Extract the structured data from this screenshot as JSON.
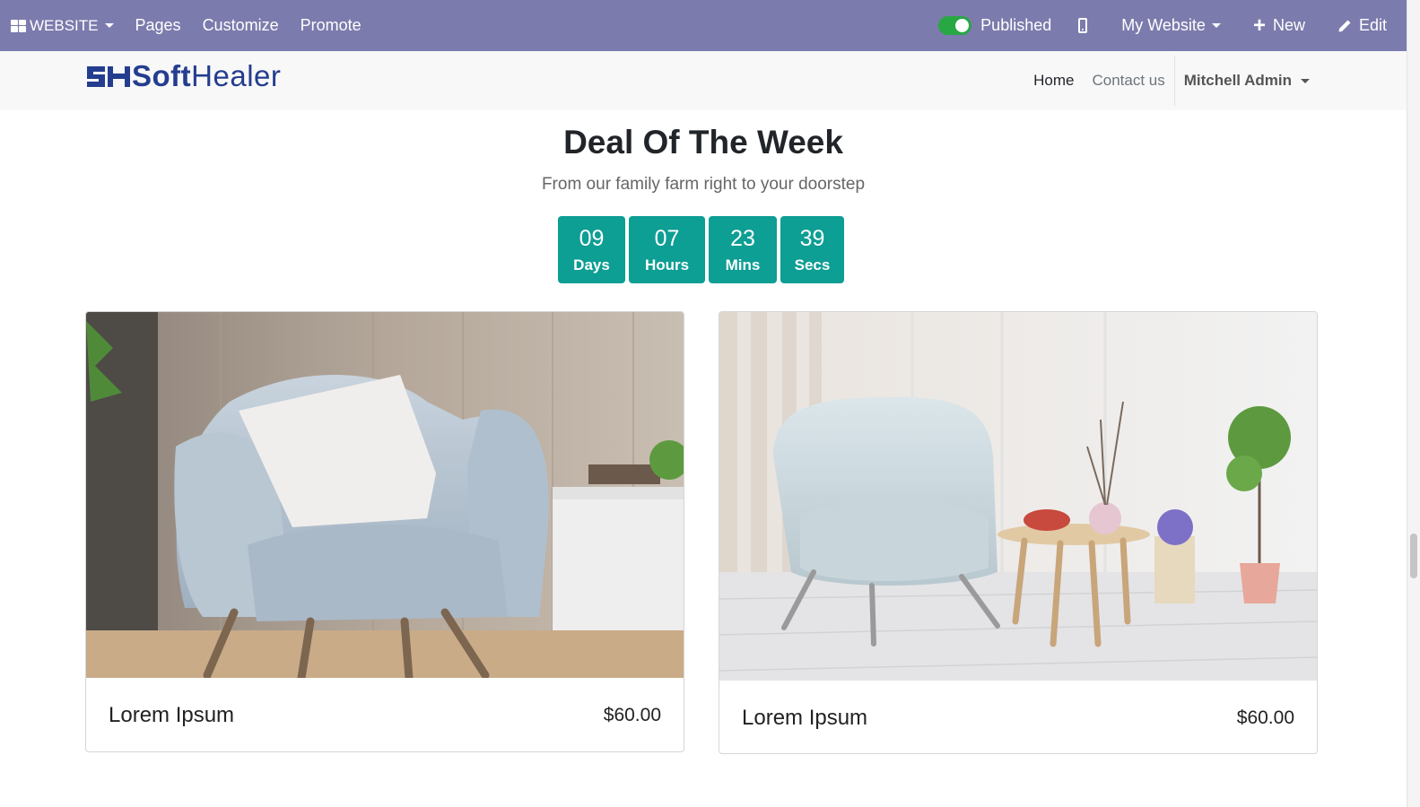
{
  "adminbar": {
    "app_label": "WEBSITE",
    "menu": [
      "Pages",
      "Customize",
      "Promote"
    ],
    "published_label": "Published",
    "website_label": "My Website",
    "new_label": "New",
    "edit_label": "Edit",
    "bar_color": "#7c7bad"
  },
  "header": {
    "logo_text_bold": "Soft",
    "logo_text": "Healer",
    "nav": [
      "Home",
      "Contact us"
    ],
    "user": "Mitchell Admin"
  },
  "deal": {
    "title": "Deal Of The Week",
    "subtitle": "From our family farm right to your doorstep",
    "countdown": [
      {
        "value": "09",
        "label": "Days"
      },
      {
        "value": "07",
        "label": "Hours"
      },
      {
        "value": "23",
        "label": "Mins"
      },
      {
        "value": "39",
        "label": "Secs"
      }
    ],
    "accent_color": "#0d9e94"
  },
  "products": [
    {
      "name": "Lorem Ipsum",
      "price": "$60.00"
    },
    {
      "name": "Lorem Ipsum",
      "price": "$60.00"
    }
  ]
}
